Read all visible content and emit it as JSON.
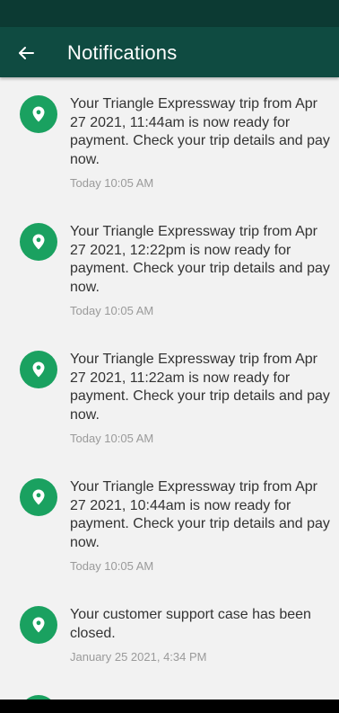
{
  "header": {
    "title": "Notifications"
  },
  "colors": {
    "status_bar": "#0c3a33",
    "app_bar": "#0f4b41",
    "background": "#f2f2f2",
    "accent_green": "#1aa160",
    "message_text": "#333333",
    "time_text": "#9a9a9a"
  },
  "icons": {
    "back": "arrow-back-icon",
    "notification": "location-pin-icon"
  },
  "notifications": [
    {
      "message": "Your Triangle Expressway trip from Apr 27 2021, 11:44am is now ready for payment. Check your trip details and pay now.",
      "time": "Today 10:05 AM"
    },
    {
      "message": "Your Triangle Expressway trip from Apr 27 2021, 12:22pm is now ready for payment. Check your trip details and pay now.",
      "time": "Today 10:05 AM"
    },
    {
      "message": "Your Triangle Expressway trip from Apr 27 2021, 11:22am is now ready for payment. Check your trip details and pay now.",
      "time": "Today 10:05 AM"
    },
    {
      "message": "Your Triangle Expressway trip from Apr 27 2021, 10:44am is now ready for payment. Check your trip details and pay now.",
      "time": "Today 10:05 AM"
    },
    {
      "message": "Your customer support case has been closed.",
      "time": "January 25 2021, 4:34 PM"
    },
    {
      "message": "",
      "time": ""
    }
  ]
}
